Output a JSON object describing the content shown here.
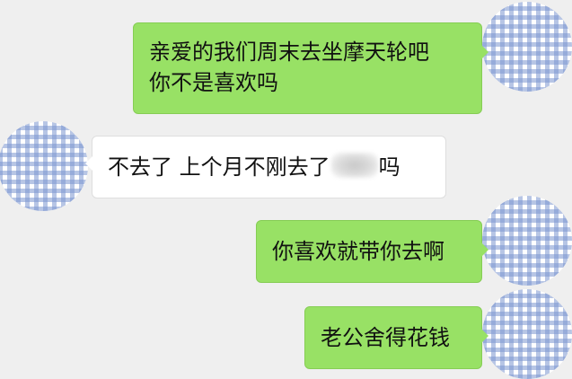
{
  "conversation": {
    "messages": [
      {
        "side": "sent",
        "lines": [
          "亲爱的我们周末去坐摩天轮吧",
          "你不是喜欢吗"
        ]
      },
      {
        "side": "received",
        "text_before": "不去了 上个月不刚去了",
        "text_after": "吗"
      },
      {
        "side": "sent",
        "text": "你喜欢就带你去啊"
      },
      {
        "side": "sent",
        "text": "老公舍得花钱"
      }
    ]
  },
  "colors": {
    "background": "#efefef",
    "sent_bubble": "#98e165",
    "received_bubble": "#ffffff",
    "avatar_pattern": "#7c96d0"
  },
  "icons": {
    "avatar": "gingham-check-avatar",
    "redaction": "blurred-text-redaction"
  }
}
